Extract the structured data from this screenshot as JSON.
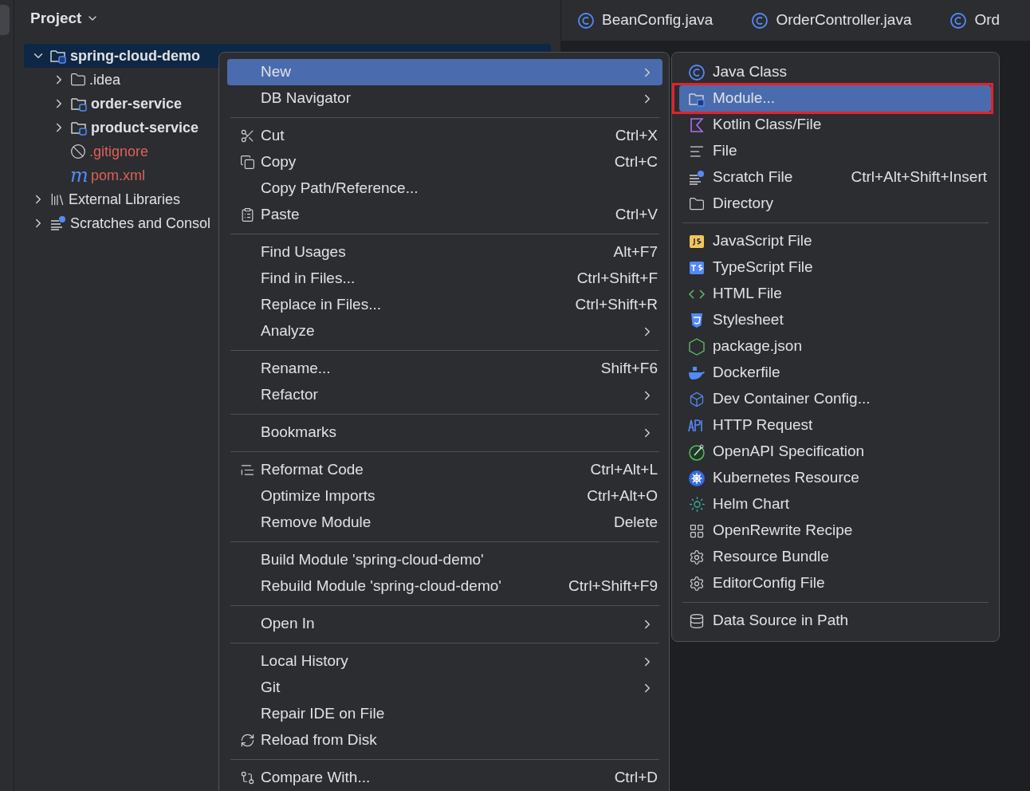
{
  "project_panel": {
    "title": "Project",
    "tree": [
      {
        "label": "spring-cloud-demo",
        "kind": "module",
        "bold": true,
        "expanded": true,
        "selected": true,
        "color": "#dfe1e5",
        "children": [
          {
            "label": ".idea",
            "kind": "folder",
            "bold": false,
            "expanded": false,
            "selected": false,
            "color": "#dfe1e5"
          },
          {
            "label": "order-service",
            "kind": "module",
            "bold": true,
            "expanded": false,
            "selected": false,
            "color": "#dfe1e5"
          },
          {
            "label": "product-service",
            "kind": "module",
            "bold": true,
            "expanded": false,
            "selected": false,
            "color": "#dfe1e5"
          },
          {
            "label": ".gitignore",
            "kind": "ignore-file",
            "bold": false,
            "selected": false,
            "color": "#e0605a"
          },
          {
            "label": "pom.xml",
            "kind": "maven-file",
            "icon_text": "m",
            "bold": false,
            "selected": false,
            "color": "#e0605a"
          }
        ]
      },
      {
        "label": "External Libraries",
        "kind": "libraries",
        "bold": false,
        "expanded": false,
        "selected": false,
        "color": "#dfe1e5"
      },
      {
        "label": "Scratches and Consol",
        "kind": "scratches",
        "bold": false,
        "expanded": false,
        "selected": false,
        "color": "#dfe1e5"
      }
    ]
  },
  "editor_tabs": [
    {
      "label": "BeanConfig.java"
    },
    {
      "label": "OrderController.java"
    },
    {
      "label": "Ord"
    }
  ],
  "context_menu": {
    "items": [
      {
        "kind": "item",
        "label": "New",
        "submenu": true,
        "selected": true
      },
      {
        "kind": "item",
        "label": "DB Navigator",
        "submenu": true,
        "selected": false
      },
      {
        "kind": "separator"
      },
      {
        "kind": "item",
        "label": "Cut",
        "shortcut": "Ctrl+X",
        "submenu": false,
        "selected": false
      },
      {
        "kind": "item",
        "label": "Copy",
        "shortcut": "Ctrl+C",
        "submenu": false,
        "selected": false
      },
      {
        "kind": "item",
        "label": "Copy Path/Reference...",
        "submenu": false,
        "selected": false
      },
      {
        "kind": "item",
        "label": "Paste",
        "shortcut": "Ctrl+V",
        "submenu": false,
        "selected": false
      },
      {
        "kind": "separator"
      },
      {
        "kind": "item",
        "label": "Find Usages",
        "shortcut": "Alt+F7",
        "submenu": false,
        "selected": false
      },
      {
        "kind": "item",
        "label": "Find in Files...",
        "shortcut": "Ctrl+Shift+F",
        "submenu": false,
        "selected": false
      },
      {
        "kind": "item",
        "label": "Replace in Files...",
        "shortcut": "Ctrl+Shift+R",
        "submenu": false,
        "selected": false
      },
      {
        "kind": "item",
        "label": "Analyze",
        "submenu": true,
        "selected": false
      },
      {
        "kind": "separator"
      },
      {
        "kind": "item",
        "label": "Rename...",
        "shortcut": "Shift+F6",
        "submenu": false,
        "selected": false
      },
      {
        "kind": "item",
        "label": "Refactor",
        "submenu": true,
        "selected": false
      },
      {
        "kind": "separator"
      },
      {
        "kind": "item",
        "label": "Bookmarks",
        "submenu": true,
        "selected": false
      },
      {
        "kind": "separator"
      },
      {
        "kind": "item",
        "label": "Reformat Code",
        "shortcut": "Ctrl+Alt+L",
        "submenu": false,
        "selected": false
      },
      {
        "kind": "item",
        "label": "Optimize Imports",
        "shortcut": "Ctrl+Alt+O",
        "submenu": false,
        "selected": false
      },
      {
        "kind": "item",
        "label": "Remove Module",
        "shortcut": "Delete",
        "submenu": false,
        "selected": false
      },
      {
        "kind": "separator"
      },
      {
        "kind": "item",
        "label": "Build Module 'spring-cloud-demo'",
        "submenu": false,
        "selected": false
      },
      {
        "kind": "item",
        "label": "Rebuild Module 'spring-cloud-demo'",
        "shortcut": "Ctrl+Shift+F9",
        "submenu": false,
        "selected": false
      },
      {
        "kind": "separator"
      },
      {
        "kind": "item",
        "label": "Open In",
        "submenu": true,
        "selected": false
      },
      {
        "kind": "separator"
      },
      {
        "kind": "item",
        "label": "Local History",
        "submenu": true,
        "selected": false
      },
      {
        "kind": "item",
        "label": "Git",
        "submenu": true,
        "selected": false
      },
      {
        "kind": "item",
        "label": "Repair IDE on File",
        "submenu": false,
        "selected": false
      },
      {
        "kind": "item",
        "label": "Reload from Disk",
        "submenu": false,
        "selected": false
      },
      {
        "kind": "separator"
      },
      {
        "kind": "item",
        "label": "Compare With...",
        "shortcut": "Ctrl+D",
        "submenu": false,
        "selected": false
      }
    ]
  },
  "new_submenu": {
    "items": [
      {
        "kind": "item",
        "label": "Java Class",
        "selected": false,
        "outlined": false
      },
      {
        "kind": "item",
        "label": "Module...",
        "selected": true,
        "outlined": true
      },
      {
        "kind": "item",
        "label": "Kotlin Class/File",
        "selected": false,
        "outlined": false
      },
      {
        "kind": "item",
        "label": "File",
        "selected": false,
        "outlined": false
      },
      {
        "kind": "item",
        "label": "Scratch File",
        "shortcut": "Ctrl+Alt+Shift+Insert",
        "selected": false,
        "outlined": false
      },
      {
        "kind": "item",
        "label": "Directory",
        "selected": false,
        "outlined": false
      },
      {
        "kind": "separator"
      },
      {
        "kind": "item",
        "label": "JavaScript File",
        "selected": false,
        "outlined": false
      },
      {
        "kind": "item",
        "label": "TypeScript File",
        "selected": false,
        "outlined": false
      },
      {
        "kind": "item",
        "label": "HTML File",
        "selected": false,
        "outlined": false
      },
      {
        "kind": "item",
        "label": "Stylesheet",
        "selected": false,
        "outlined": false
      },
      {
        "kind": "item",
        "label": "package.json",
        "selected": false,
        "outlined": false
      },
      {
        "kind": "item",
        "label": "Dockerfile",
        "selected": false,
        "outlined": false
      },
      {
        "kind": "item",
        "label": "Dev Container Config...",
        "selected": false,
        "outlined": false
      },
      {
        "kind": "item",
        "label": "HTTP Request",
        "selected": false,
        "outlined": false
      },
      {
        "kind": "item",
        "label": "OpenAPI Specification",
        "selected": false,
        "outlined": false
      },
      {
        "kind": "item",
        "label": "Kubernetes Resource",
        "selected": false,
        "outlined": false
      },
      {
        "kind": "item",
        "label": "Helm Chart",
        "selected": false,
        "outlined": false
      },
      {
        "kind": "item",
        "label": "OpenRewrite Recipe",
        "selected": false,
        "outlined": false
      },
      {
        "kind": "item",
        "label": "Resource Bundle",
        "selected": false,
        "outlined": false
      },
      {
        "kind": "item",
        "label": "EditorConfig File",
        "selected": false,
        "outlined": false
      },
      {
        "kind": "separator"
      },
      {
        "kind": "item",
        "label": "Data Source in Path",
        "selected": false,
        "outlined": false
      }
    ]
  }
}
